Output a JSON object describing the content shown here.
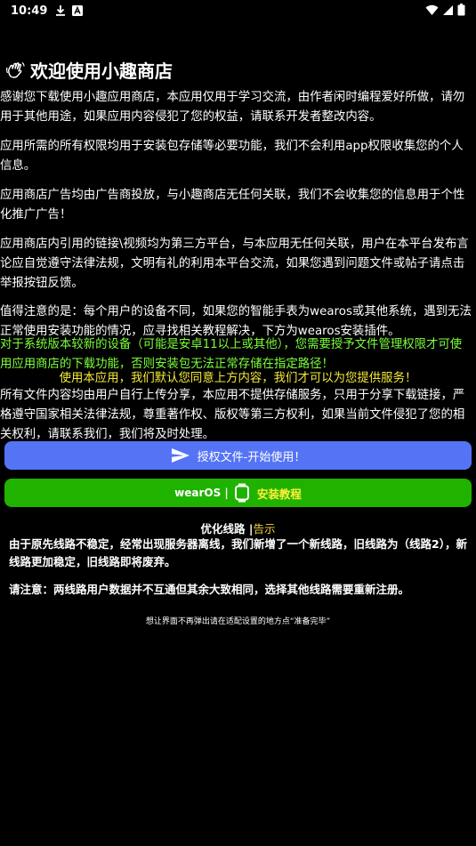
{
  "status_bar": {
    "time": "10:49"
  },
  "title": "欢迎使用小趣商店",
  "paragraphs": {
    "p1": "感谢您下载使用小趣应用商店，本应用仅用于学习交流，由作者闲时编程爱好所做，请勿用于其他用途，如果应用内容侵犯了您的权益，请联系开发者整改内容。",
    "p2": "应用所需的所有权限均用于安装包存储等必要功能，我们不会利用app权限收集您的个人信息。",
    "p3": "应用商店广告均由广告商投放，与小趣商店无任何关联，我们不会收集您的信息用于个性化推广广告！",
    "p4": "应用商店内引用的链接\\视频均为第三方平台，与本应用无任何关联，用户在本平台发布言论应自觉遵守法律法规，文明有礼的利用本平台交流，如果您遇到问题文件或帖子请点击举报按钮反馈。",
    "p5": "值得注意的是：每个用户的设备不同，如果您的智能手表为wearos或其他系统，遇到无法正常使用安装功能的情况，应寻找相关教程解决，下方为wearos安装插件。",
    "p6": "对于系统版本较新的设备（可能是安卓11以上或其他），您需要授予文件管理权限才可使用应用商店的下载功能，否则安装包无法正常存储在指定路径！",
    "p7": "使用本应用，我们默认您同意上方内容，我们才可以为您提供服务！",
    "p8": "所有文件内容均由用户自行上传分享，本应用不提供存储服务，只用于分享下载链接，严格遵守国家相关法律法规，尊重著作权、版权等第三方权利，如果当前文件侵犯了您的相关权利，请联系我们，我们将及时处理。"
  },
  "buttons": {
    "auth": "授权文件-开始使用！",
    "wear_label": "wearOS |",
    "wear_tutorial": "安装教程"
  },
  "line_section": {
    "title": "优化线路 |",
    "notice": "告示",
    "note1": "由于原先线路不稳定，经常出现服务器离线，我们新增了一个新线路，旧线路为（线路2），新线路更加稳定，旧线路即将废弃。",
    "note2": "请注意：两线路用户数据并不互通但其余大致相同，选择其他线路需要重新注册。"
  },
  "tip": "想让界面不再弹出请在适配设置的地方点“准备完毕”",
  "colors": {
    "background": "#000000",
    "auth_button": "#5474f5",
    "wear_button": "#1fb300",
    "green_text": "#7cff3c",
    "yellow_text": "#f5ea3a"
  }
}
